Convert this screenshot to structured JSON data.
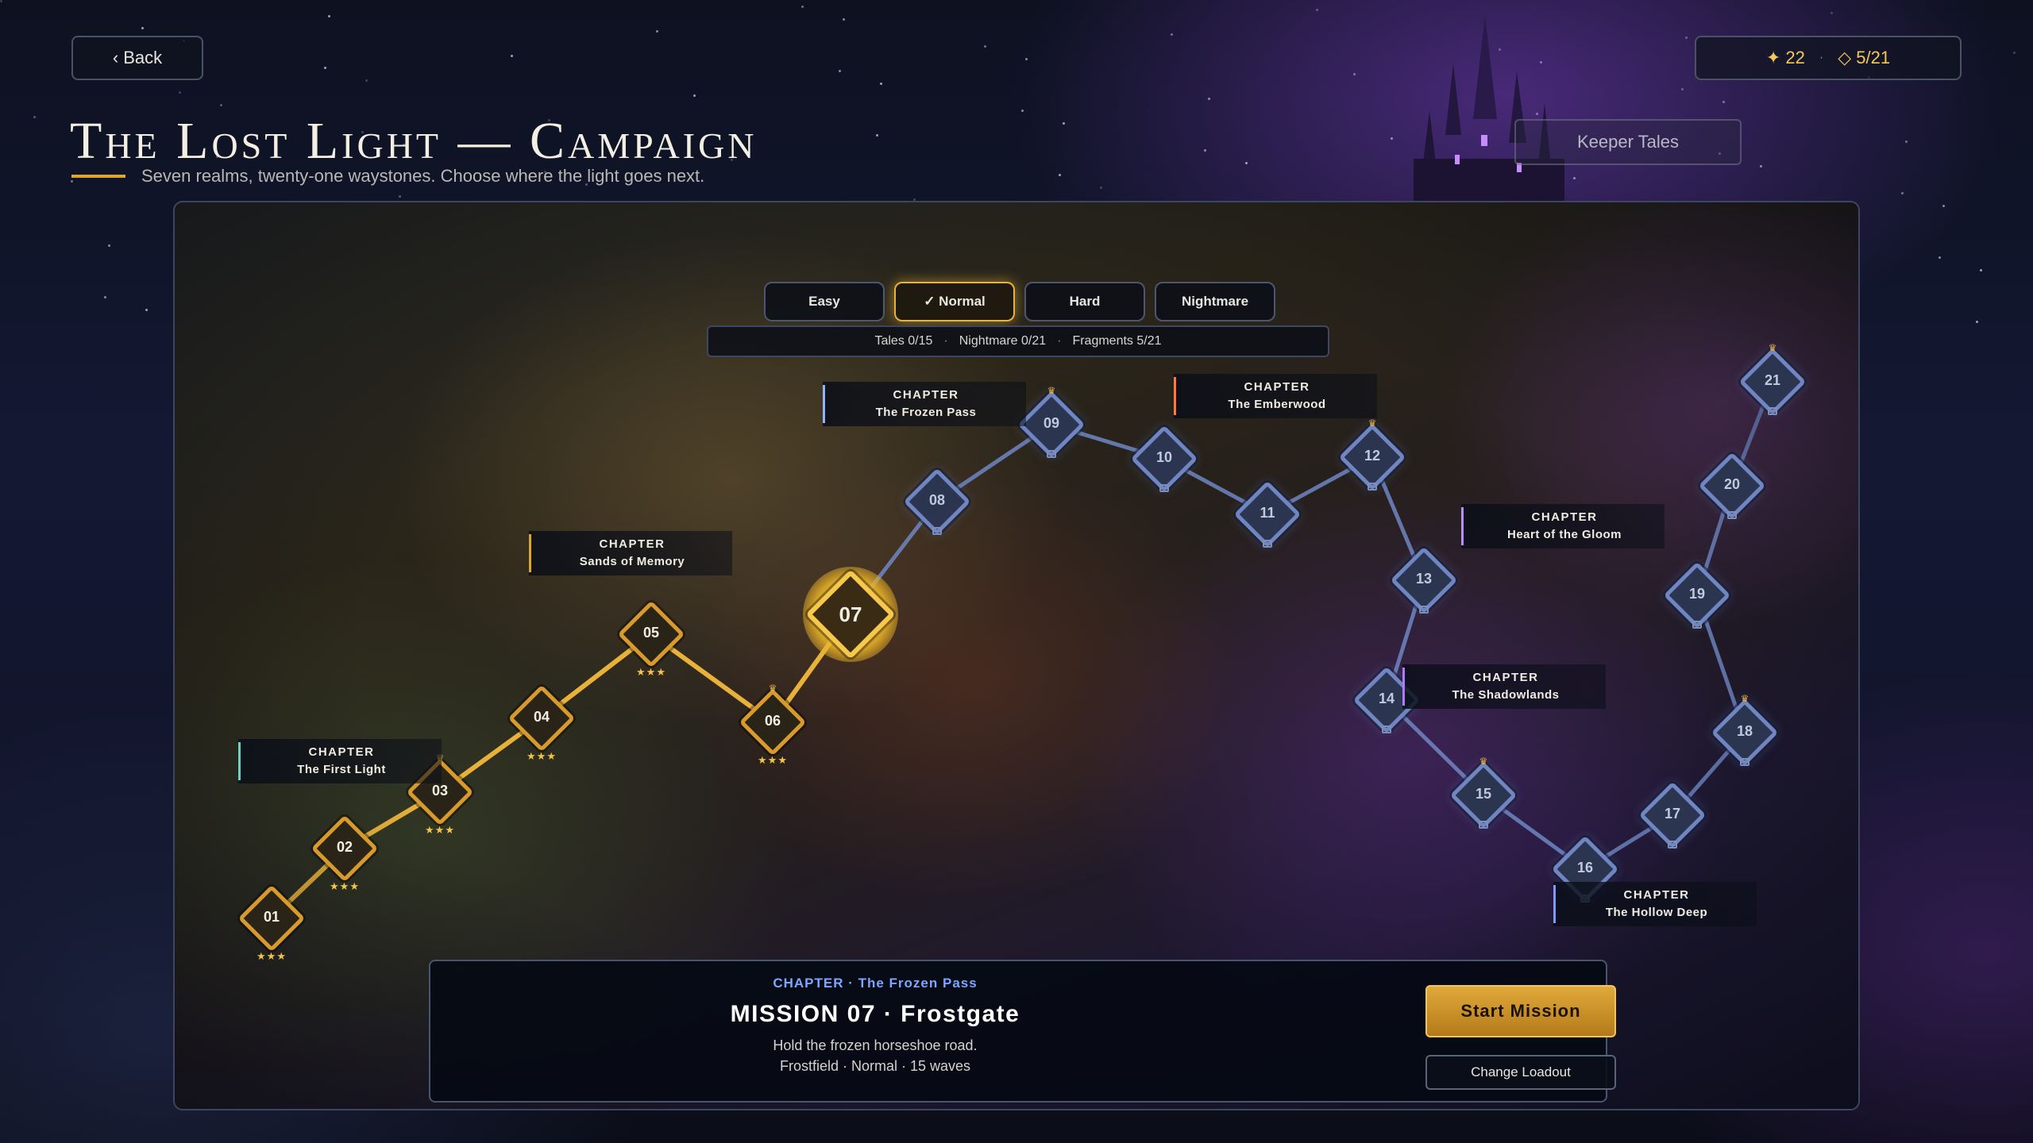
{
  "header": {
    "back_label": "‹ Back",
    "currency_stars": "✦ 22",
    "currency_fragments": "◇ 5/21",
    "title": "The Lost Light — Campaign",
    "subtitle": "Seven realms, twenty-one waystones. Choose where the light goes next.",
    "keeper_tales_label": "Keeper Tales"
  },
  "difficulty": {
    "options": [
      "Easy",
      "✓ Normal",
      "Hard",
      "Nightmare"
    ],
    "selected": "Normal"
  },
  "stats": {
    "tales": "Tales 0/15",
    "nightmare": "Nightmare 0/21",
    "fragments": "Fragments 5/21"
  },
  "chapters": [
    {
      "kicker": "CHAPTER",
      "name": "The First Light",
      "color": "#6fd0c4"
    },
    {
      "kicker": "CHAPTER",
      "name": "Sands of Memory",
      "color": "#e0a52a"
    },
    {
      "kicker": "CHAPTER",
      "name": "The Frozen Pass",
      "color": "#8fb4ff"
    },
    {
      "kicker": "CHAPTER",
      "name": "The Emberwood",
      "color": "#ff7a3a"
    },
    {
      "kicker": "CHAPTER",
      "name": "Heart of the Gloom",
      "color": "#c38aff"
    },
    {
      "kicker": "CHAPTER",
      "name": "The Shadowlands",
      "color": "#b07aff"
    },
    {
      "kicker": "CHAPTER",
      "name": "The Hollow Deep",
      "color": "#7a9cff"
    }
  ],
  "nodes": [
    {
      "num": "01",
      "state": "completed",
      "stars": "★★★",
      "crown": ""
    },
    {
      "num": "02",
      "state": "completed",
      "stars": "★★★",
      "crown": ""
    },
    {
      "num": "03",
      "state": "completed",
      "stars": "★★★",
      "crown": "♛"
    },
    {
      "num": "04",
      "state": "completed",
      "stars": "★★★",
      "crown": ""
    },
    {
      "num": "05",
      "state": "completed",
      "stars": "★★★",
      "crown": ""
    },
    {
      "num": "06",
      "state": "completed",
      "stars": "★★★",
      "crown": "♛"
    },
    {
      "num": "07",
      "state": "current",
      "stars": "",
      "crown": ""
    },
    {
      "num": "08",
      "state": "locked",
      "stars": "",
      "crown": ""
    },
    {
      "num": "09",
      "state": "locked",
      "stars": "",
      "crown": "♛"
    },
    {
      "num": "10",
      "state": "locked",
      "stars": "",
      "crown": ""
    },
    {
      "num": "11",
      "state": "locked",
      "stars": "",
      "crown": ""
    },
    {
      "num": "12",
      "state": "locked",
      "stars": "",
      "crown": "♛"
    },
    {
      "num": "13",
      "state": "locked",
      "stars": "",
      "crown": ""
    },
    {
      "num": "14",
      "state": "locked",
      "stars": "",
      "crown": ""
    },
    {
      "num": "15",
      "state": "locked",
      "stars": "",
      "crown": "♛"
    },
    {
      "num": "16",
      "state": "locked",
      "stars": "",
      "crown": ""
    },
    {
      "num": "17",
      "state": "locked",
      "stars": "",
      "crown": ""
    },
    {
      "num": "18",
      "state": "locked",
      "stars": "",
      "crown": "♛"
    },
    {
      "num": "19",
      "state": "locked",
      "stars": "",
      "crown": ""
    },
    {
      "num": "20",
      "state": "locked",
      "stars": "",
      "crown": ""
    },
    {
      "num": "21",
      "state": "locked",
      "stars": "",
      "crown": "♛"
    }
  ],
  "mission": {
    "chapter_line": "CHAPTER · The Frozen Pass",
    "title": "MISSION 07 · Frostgate",
    "description": "Hold the frozen horseshoe road.",
    "meta": "Frostfield · Normal · 15 waves",
    "start_label": "Start Mission",
    "loadout_label": "Change Loadout"
  },
  "colors": {
    "accent_gold": "#e0a52a",
    "path_completed": "#e8b13a",
    "path_locked": "#6f86c2"
  }
}
